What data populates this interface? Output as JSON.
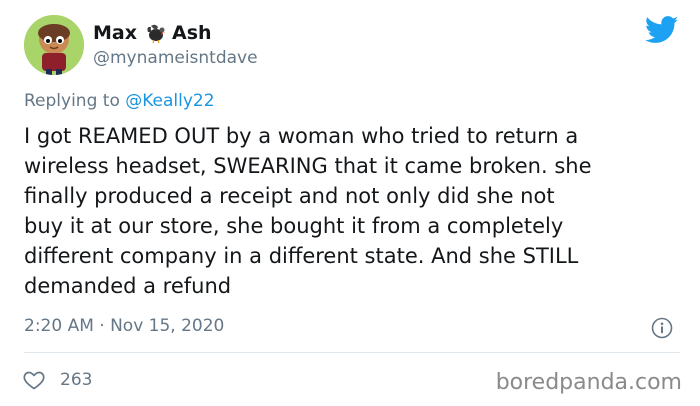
{
  "user": {
    "name_first": "Max",
    "name_emoji": "turkey-icon",
    "name_last": "Ash",
    "handle": "@mynameisntdave"
  },
  "reply": {
    "prefix": "Replying to",
    "mention": "@Keally22"
  },
  "tweet": {
    "lines": [
      "I got REAMED OUT by a woman who tried to return a",
      "wireless headset, SWEARING that it came broken. she",
      "finally produced a receipt and not only did she not",
      "buy it at our store, she bought it from a completely",
      "different company in a different state. And she STILL",
      "demanded a refund"
    ],
    "timestamp": "2:20 AM · Nov 15, 2020"
  },
  "stats": {
    "likes": "263"
  },
  "watermark": "boredpanda.com",
  "colors": {
    "accent": "#1da1f2",
    "muted": "#657786",
    "text": "#14171a",
    "divider": "#e1e8ed"
  }
}
